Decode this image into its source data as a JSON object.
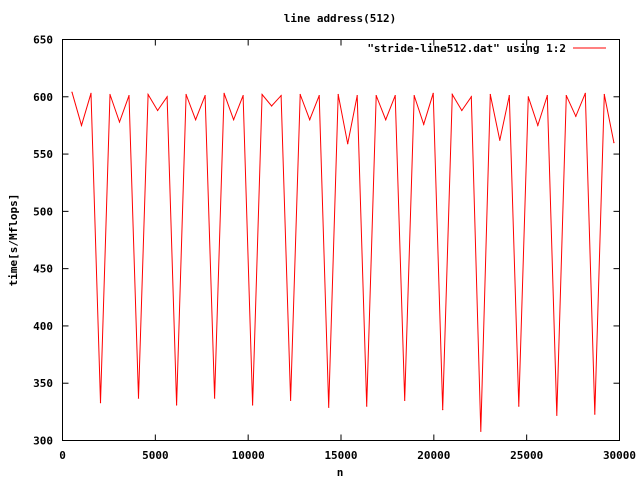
{
  "chart_data": {
    "type": "line",
    "title": "line address(512)",
    "xlabel": "n",
    "ylabel": "time[s/Mflops]",
    "xlim": [
      0,
      30000
    ],
    "ylim": [
      300,
      650
    ],
    "x_ticks": [
      "0",
      "5000",
      "10000",
      "15000",
      "20000",
      "25000",
      "30000"
    ],
    "y_ticks": [
      "300",
      "350",
      "400",
      "450",
      "500",
      "550",
      "600",
      "650"
    ],
    "grid": false,
    "legend_position": "top-right",
    "series": [
      {
        "name": "\"stride-line512.dat\" using 1:2",
        "color": "#ff0000",
        "x": [
          512,
          1024,
          1536,
          2048,
          2560,
          3072,
          3584,
          4096,
          4608,
          5120,
          5632,
          6144,
          6656,
          7168,
          7680,
          8192,
          8704,
          9216,
          9728,
          10240,
          10752,
          11264,
          11776,
          12288,
          12800,
          13312,
          13824,
          14336,
          14848,
          15360,
          15872,
          16384,
          16896,
          17408,
          17920,
          18432,
          18944,
          19456,
          19968,
          20480,
          20992,
          21504,
          22016,
          22528,
          23040,
          23552,
          24064,
          24576,
          25088,
          25600,
          26112,
          26624,
          27136,
          27648,
          28160,
          28672,
          29184,
          29696
        ],
        "y": [
          604,
          575,
          603,
          333,
          602,
          578,
          601,
          337,
          602,
          588,
          600,
          331,
          602,
          580,
          601,
          337,
          603,
          580,
          601,
          331,
          602,
          592,
          601,
          335,
          602,
          580,
          601,
          329,
          602,
          559,
          601,
          330,
          601,
          580,
          601,
          335,
          601,
          576,
          603,
          327,
          602,
          588,
          600,
          308,
          602,
          562,
          601,
          330,
          600,
          575,
          601,
          322,
          601,
          583,
          603,
          323,
          602,
          560
        ]
      }
    ]
  }
}
